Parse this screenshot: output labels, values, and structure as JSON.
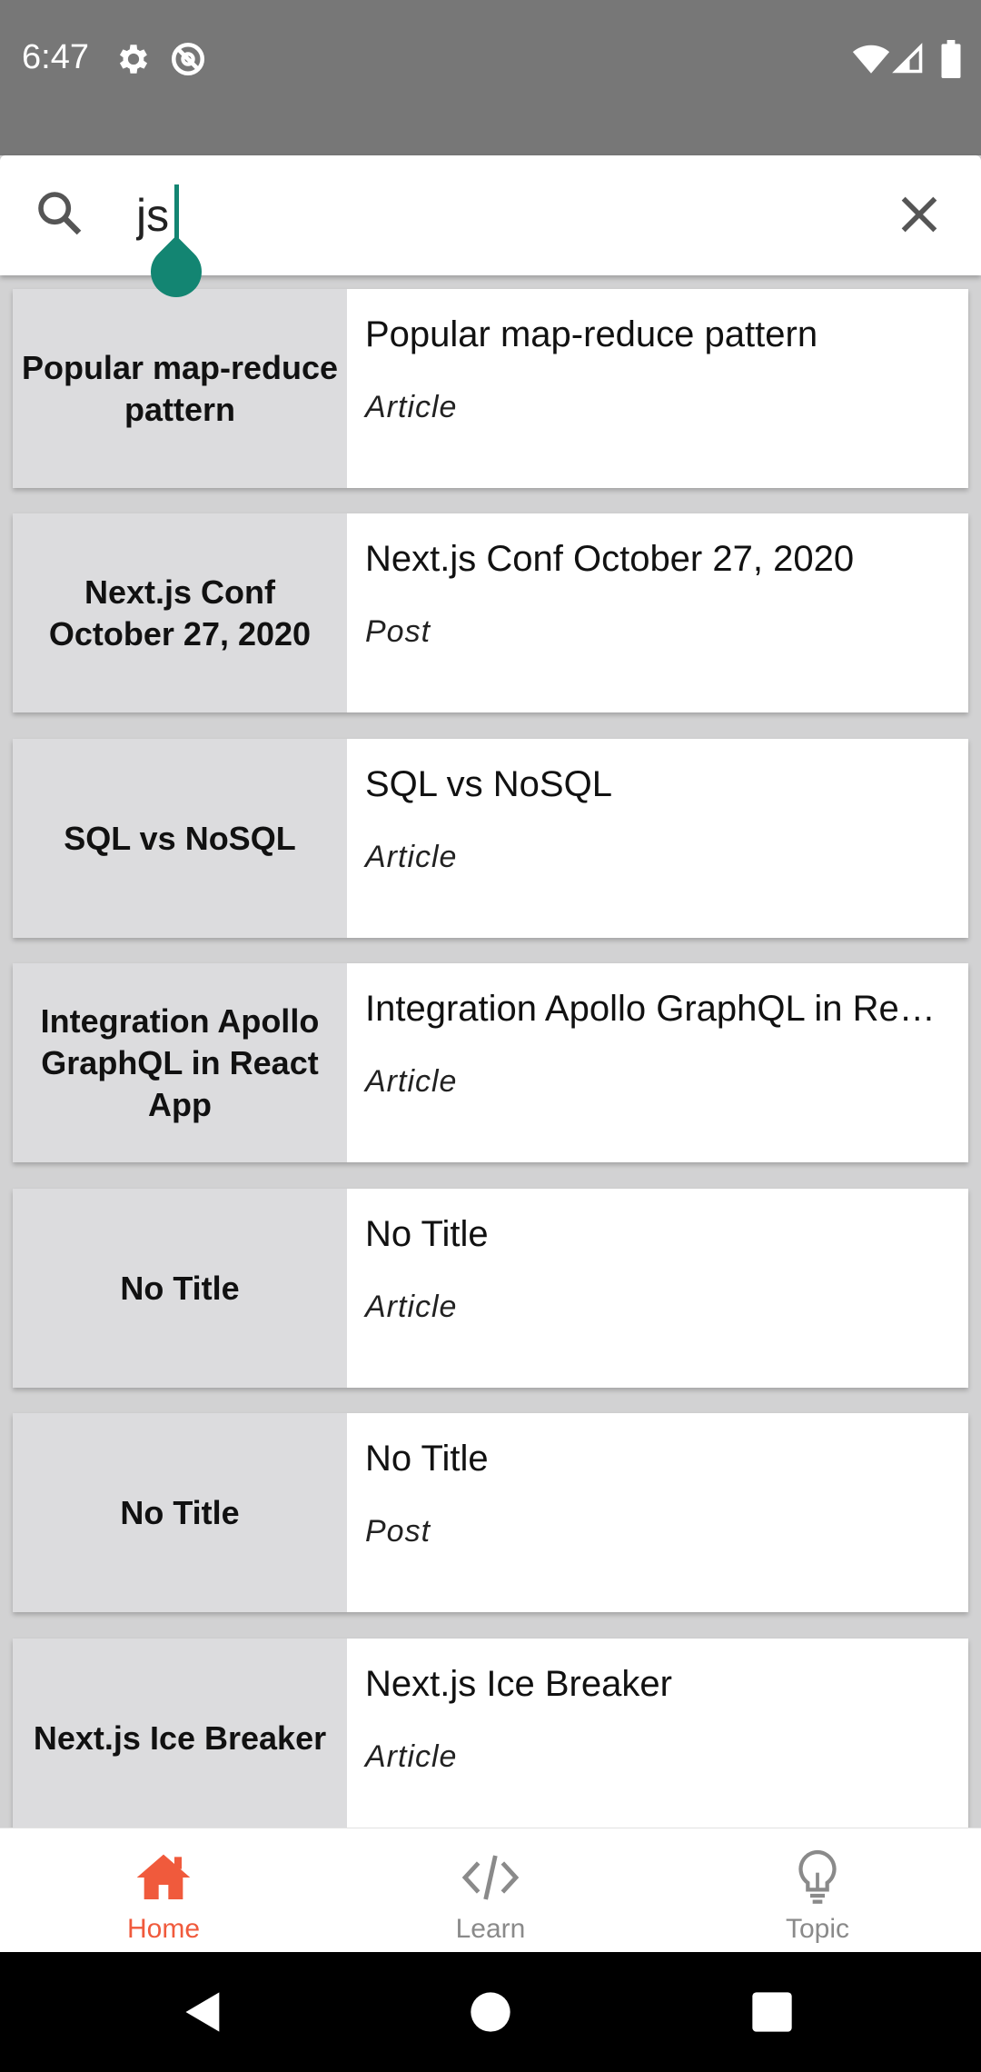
{
  "status_bar": {
    "time": "6:47"
  },
  "search": {
    "query": "js",
    "placeholder": ""
  },
  "results": [
    {
      "thumb": "Popular map-reduce pattern",
      "title": "Popular map-reduce pattern",
      "type": "Article"
    },
    {
      "thumb": "Next.js Conf October 27, 2020",
      "title": "Next.js Conf October 27, 2020",
      "type": "Post"
    },
    {
      "thumb": "SQL vs NoSQL",
      "title": "SQL vs NoSQL",
      "type": "Article"
    },
    {
      "thumb": "Integration Apollo GraphQL in React App",
      "title": "Integration Apollo GraphQL in Re…",
      "type": "Article"
    },
    {
      "thumb": "No Title",
      "title": "No Title",
      "type": "Article"
    },
    {
      "thumb": "No Title",
      "title": "No Title",
      "type": "Post"
    },
    {
      "thumb": "Next.js Ice Breaker",
      "title": "Next.js Ice Breaker",
      "type": "Article"
    }
  ],
  "bottom_nav": {
    "home": "Home",
    "learn": "Learn",
    "topic": "Topic"
  },
  "colors": {
    "accent": "#f05a3c",
    "caret": "#138572",
    "status_bar": "#777777"
  }
}
